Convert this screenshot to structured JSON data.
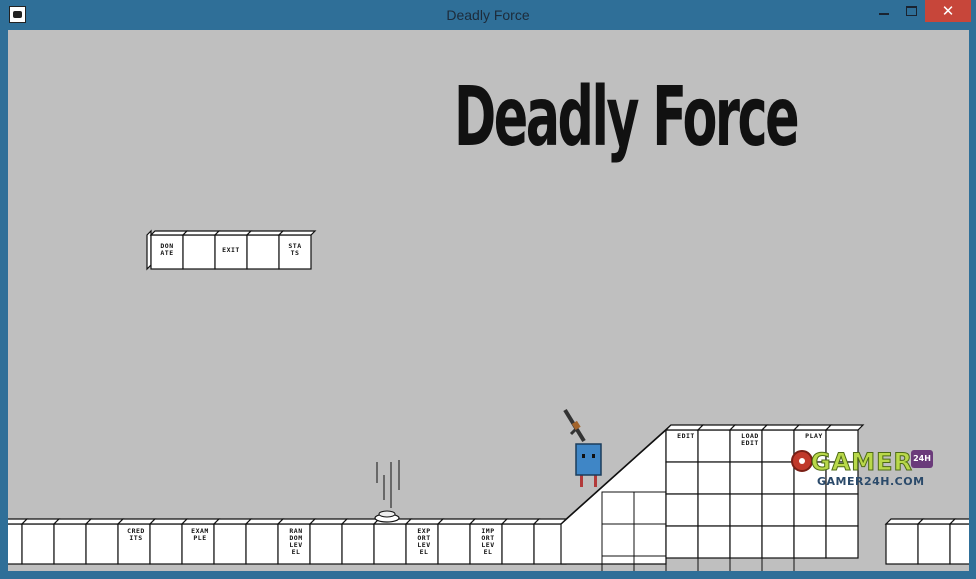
{
  "window": {
    "title": "Deadly Force",
    "close_glyph": "✕"
  },
  "game": {
    "title": "Deadly Force"
  },
  "menu_blocks": [
    {
      "lines": [
        "DON",
        "ATE"
      ]
    },
    {
      "lines": []
    },
    {
      "lines": [
        "EXIT"
      ]
    },
    {
      "lines": []
    },
    {
      "lines": [
        "STA",
        "TS"
      ]
    }
  ],
  "floor_labels": [
    {
      "col": 4,
      "lines": [
        "CRED",
        "ITS"
      ]
    },
    {
      "col": 6,
      "lines": [
        "EXAM",
        "PLE"
      ]
    },
    {
      "col": 9,
      "lines": [
        "RAN",
        "DOM",
        "LEV",
        "EL"
      ]
    },
    {
      "col": 13,
      "lines": [
        "EXP",
        "ORT",
        "LEV",
        "EL"
      ]
    },
    {
      "col": 15,
      "lines": [
        "IMP",
        "ORT",
        "LEV",
        "EL"
      ]
    }
  ],
  "platform_labels": [
    {
      "col": 0,
      "lines": [
        "EDIT"
      ]
    },
    {
      "col": 2,
      "lines": [
        "LOAD",
        "EDIT"
      ]
    },
    {
      "col": 4,
      "lines": [
        "PLAY"
      ]
    }
  ],
  "watermark": {
    "brand": "GAMER",
    "site": "GAMER24H.COM",
    "badge": "24H"
  },
  "colors": {
    "sky": "#bfbfbf",
    "tile": "#ffffff",
    "outline": "#111111",
    "player_body": "#3f86c6",
    "player_legs": "#b23a3a"
  }
}
